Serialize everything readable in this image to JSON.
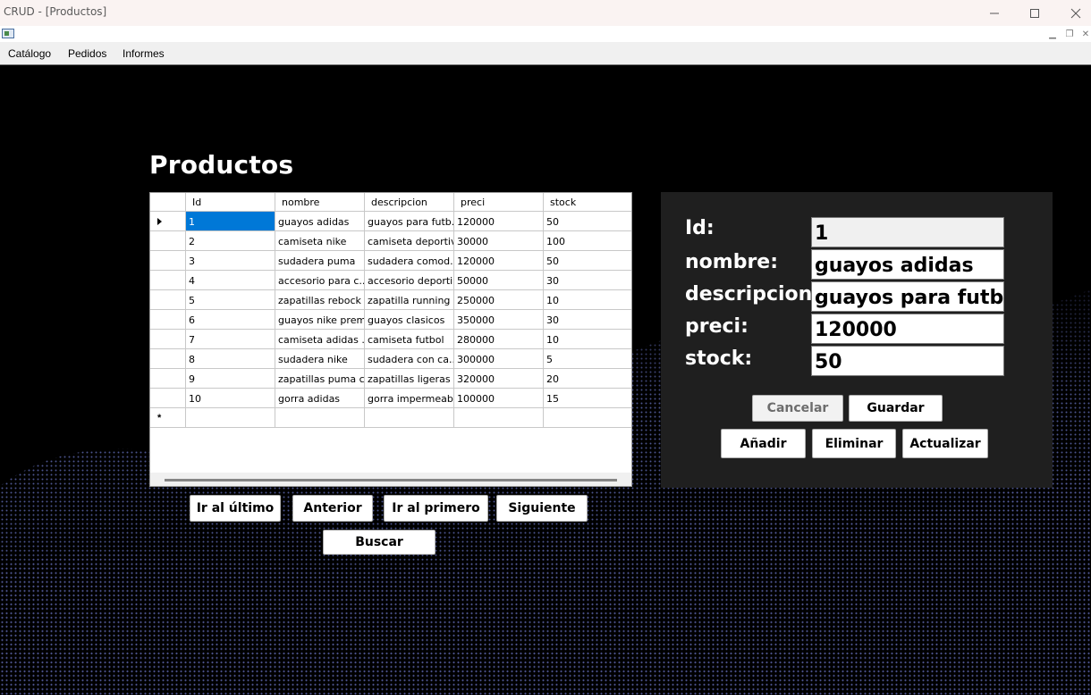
{
  "window": {
    "title": "CRUD - [Productos]"
  },
  "menu": [
    "Catálogo",
    "Pedidos",
    "Informes"
  ],
  "page": {
    "heading": "Productos"
  },
  "grid": {
    "columns": [
      "Id",
      "nombre",
      "descripcion",
      "preci",
      "stock"
    ],
    "rows": [
      [
        "1",
        "guayos adidas",
        "guayos para futb...",
        "120000",
        "50"
      ],
      [
        "2",
        "camiseta nike",
        "camiseta deportiv...",
        "30000",
        "100"
      ],
      [
        "3",
        "sudadera puma",
        "sudadera comod...",
        "120000",
        "50"
      ],
      [
        "4",
        "accesorio para c...",
        "accesorio deporti...",
        "50000",
        "30"
      ],
      [
        "5",
        "zapatillas rebock",
        "zapatilla running",
        "250000",
        "10"
      ],
      [
        "6",
        "guayos nike prem...",
        "guayos clasicos",
        "350000",
        "30"
      ],
      [
        "7",
        "camiseta adidas ...",
        "camiseta futbol",
        "280000",
        "10"
      ],
      [
        "8",
        "sudadera nike",
        "sudadera con ca...",
        "300000",
        "5"
      ],
      [
        "9",
        "zapatillas puma cl...",
        "zapatillas ligeras ...",
        "320000",
        "20"
      ],
      [
        "10",
        "gorra adidas",
        "gorra impermeabl...",
        "100000",
        "15"
      ]
    ],
    "new_row_marker": "*"
  },
  "nav_buttons": {
    "last": "Ir al último",
    "prev": "Anterior",
    "first": "Ir al primero",
    "next": "Siguiente",
    "search": "Buscar"
  },
  "detail": {
    "id_label": "Id:",
    "id_value": "1",
    "nombre_label": "nombre:",
    "nombre_value": "guayos adidas",
    "descripcion_label": "descripcion:",
    "descripcion_value": "guayos para futbol c",
    "preci_label": "preci:",
    "preci_value": "120000",
    "stock_label": "stock:",
    "stock_value": "50"
  },
  "action_buttons": {
    "cancel": "Cancelar",
    "save": "Guardar",
    "add": "Añadir",
    "delete": "Eliminar",
    "update": "Actualizar"
  },
  "colors": {
    "selection": "#0078d7",
    "panel": "#1f1f1f",
    "background": "#000000",
    "dots": "#5a63a8"
  }
}
